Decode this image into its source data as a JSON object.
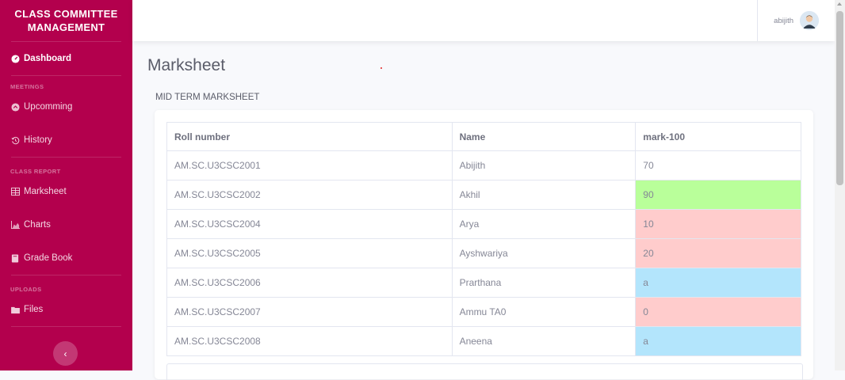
{
  "sidebar": {
    "brand_line1": "CLASS COMMITTEE",
    "brand_line2": "MANAGEMENT",
    "dashboard": "Dashboard",
    "heading_meetings": "MEETINGS",
    "upcomming": "Upcomming",
    "history": "History",
    "heading_class_report": "CLASS REPORT",
    "marksheet": "Marksheet",
    "charts": "Charts",
    "grade_book": "Grade Book",
    "heading_uploads": "UPLOADS",
    "files": "Files",
    "toggle_glyph": "‹"
  },
  "topbar": {
    "user_name": "abijith"
  },
  "page": {
    "title": "Marksheet",
    "section_title": "MID TERM MARKSHEET"
  },
  "table": {
    "headers": [
      "Roll number",
      "Name",
      "mark-100"
    ],
    "rows": [
      {
        "roll": "AM.SC.U3CSC2001",
        "name": "Abijith",
        "mark": "70"
      },
      {
        "roll": "AM.SC.U3CSC2002",
        "name": "Akhil",
        "mark": "90"
      },
      {
        "roll": "AM.SC.U3CSC2004",
        "name": "Arya",
        "mark": "10"
      },
      {
        "roll": "AM.SC.U3CSC2005",
        "name": "Ayshwariya",
        "mark": "20"
      },
      {
        "roll": "AM.SC.U3CSC2006",
        "name": "Prarthana",
        "mark": "a"
      },
      {
        "roll": "AM.SC.U3CSC2007",
        "name": "Ammu TA0",
        "mark": "0"
      },
      {
        "roll": "AM.SC.U3CSC2008",
        "name": "Aneena",
        "mark": "a"
      }
    ]
  },
  "colors": {
    "sidebar": "#b3004d",
    "mark_high": "#b9ff9a",
    "mark_low": "#ffcccc",
    "mark_absent": "#b3e5fc"
  }
}
